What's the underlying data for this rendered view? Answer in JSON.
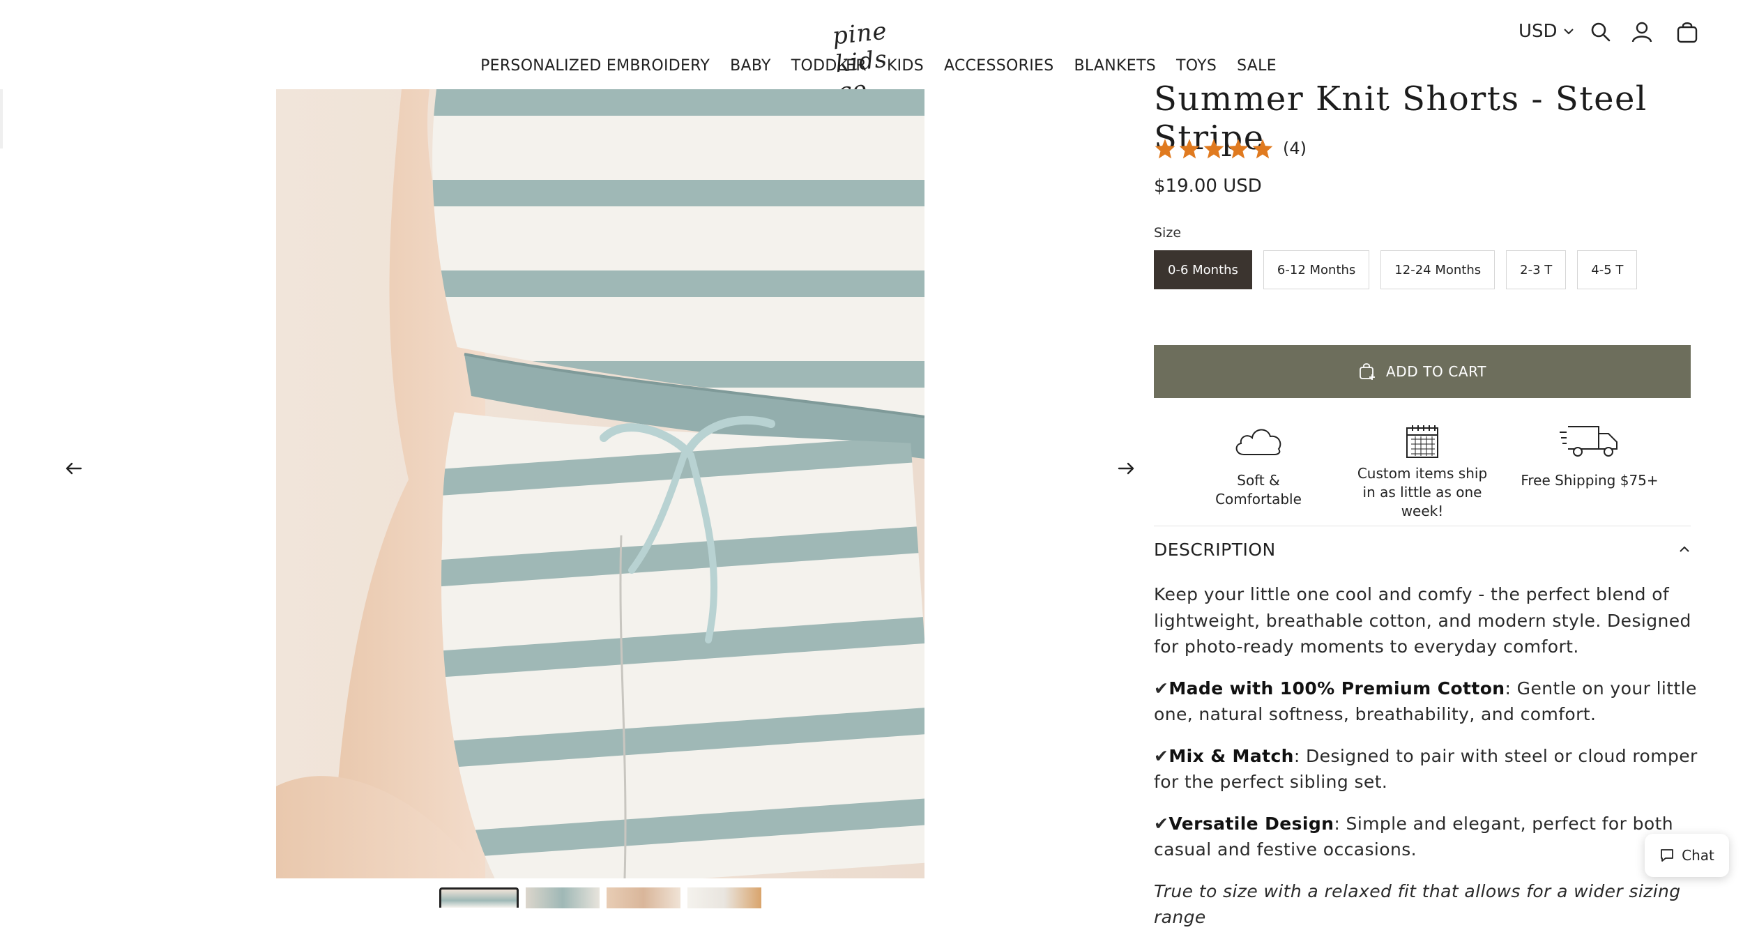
{
  "header": {
    "logo_text": "pine kids co",
    "currency": "USD",
    "icons": [
      "search-icon",
      "account-icon",
      "cart-icon"
    ]
  },
  "nav": {
    "items": [
      "PERSONALIZED EMBROIDERY",
      "BABY",
      "TODDLER",
      "KIDS",
      "ACCESSORIES",
      "BLANKETS",
      "TOYS",
      "SALE"
    ]
  },
  "gallery": {
    "prev_icon": "arrow-left-icon",
    "next_icon": "arrow-right-icon",
    "thumbnail_count": 4,
    "active_thumbnail": 1
  },
  "product": {
    "title": "Summer Knit Shorts - Steel Stripe",
    "rating": 5,
    "review_count": "(4)",
    "price": "$19.00 USD",
    "size_label": "Size",
    "sizes": [
      "0-6 Months",
      "6-12 Months",
      "12-24 Months",
      "2-3 T",
      "4-5 T"
    ],
    "selected_size": "0-6 Months",
    "add_to_cart": "ADD TO CART"
  },
  "features": [
    {
      "icon": "cloud-icon",
      "text": "Soft & Comfortable"
    },
    {
      "icon": "calendar-icon",
      "text": "Custom items ship in as little as one week!"
    },
    {
      "icon": "delivery-truck-icon",
      "text": "Free Shipping $75+"
    }
  ],
  "description": {
    "heading": "DESCRIPTION",
    "intro": "Keep your little one cool and comfy - the perfect blend of lightweight, breathable cotton, and modern style. Designed for photo-ready moments to everyday comfort.",
    "check": "✔",
    "bullets": [
      {
        "bold": "Made with 100% Premium Cotton",
        "text": ": Gentle on your little one, natural softness, breathability, and comfort."
      },
      {
        "bold": "Mix & Match",
        "text": ": Designed to pair with steel or cloud romper for the perfect sibling set."
      },
      {
        "bold": "Versatile Design",
        "text": ": Simple and elegant, perfect for both casual and festive occasions."
      }
    ],
    "fit_note": "True to size with a relaxed fit that allows for a wider sizing range"
  },
  "chat": {
    "label": "Chat"
  },
  "colors": {
    "accent": "#6d6e5c",
    "selected_size_bg": "#3b342f",
    "star": "#e07a1f",
    "stripe": "#9fb8b6"
  }
}
